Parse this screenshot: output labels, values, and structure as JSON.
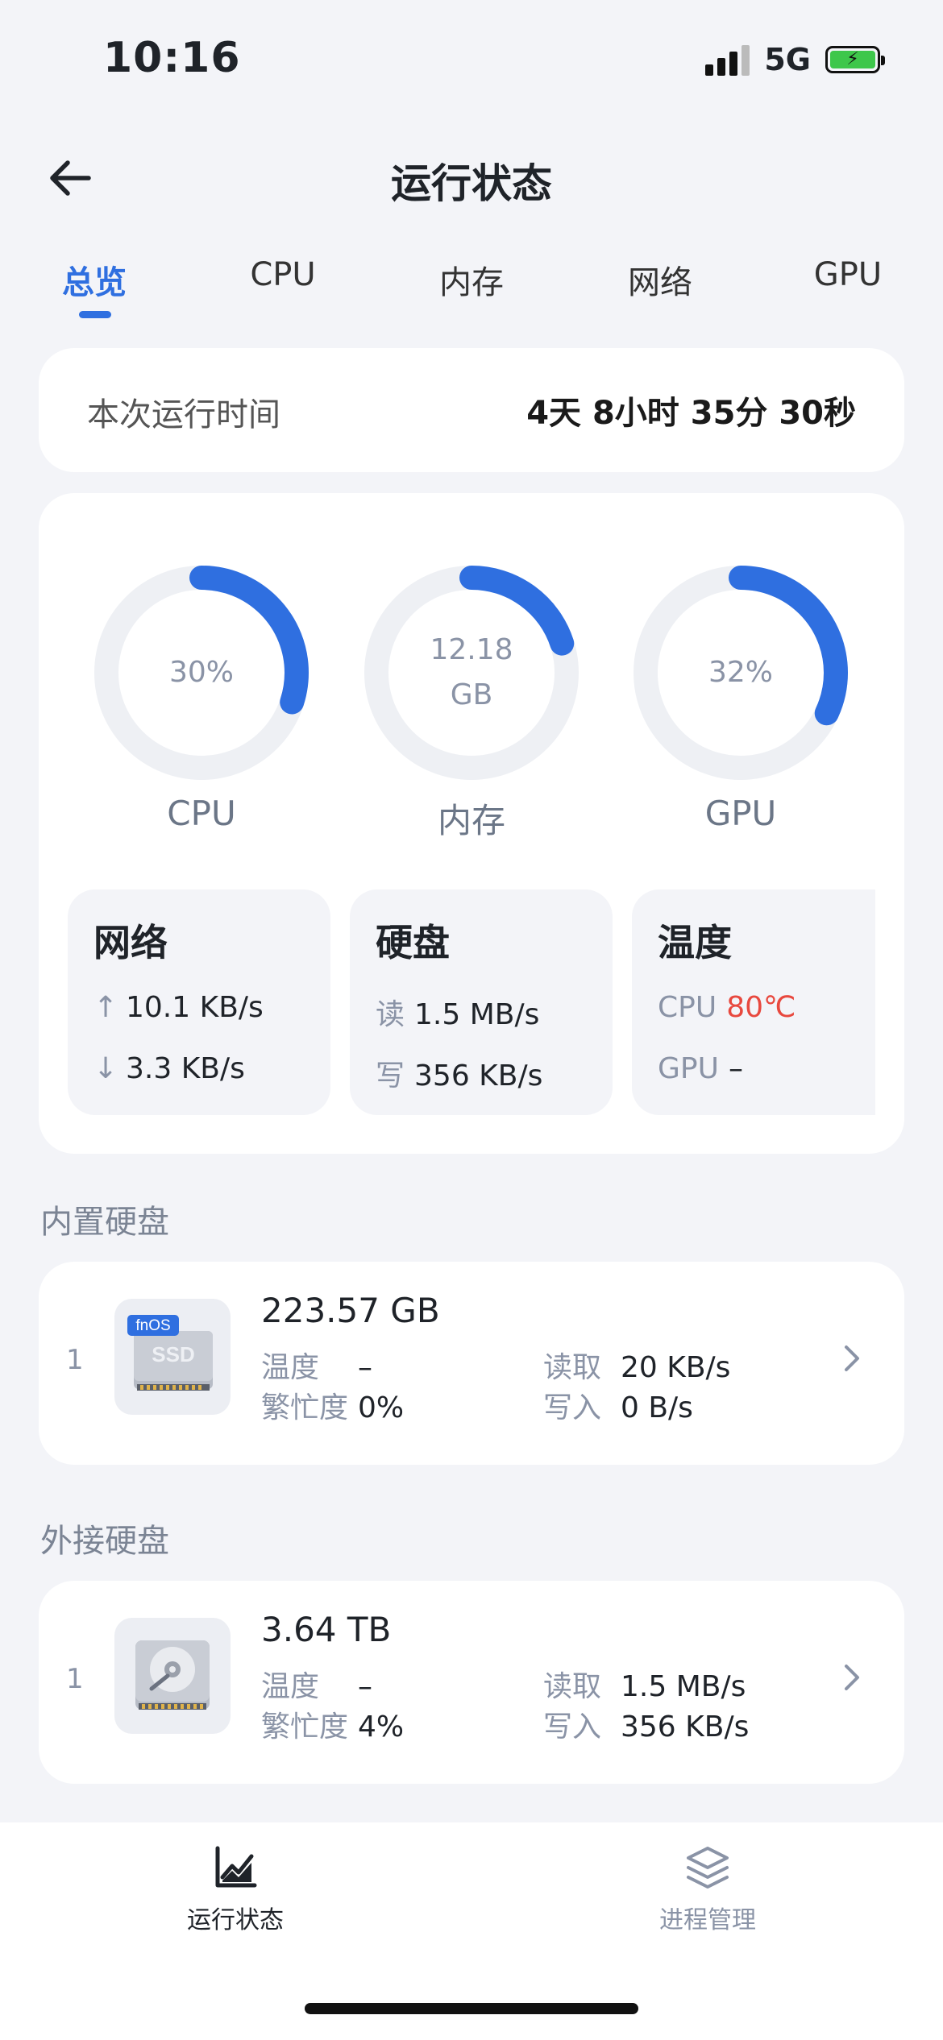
{
  "status_bar": {
    "time": "10:16",
    "network": "5G"
  },
  "header": {
    "title": "运行状态"
  },
  "tabs": [
    {
      "label": "总览",
      "active": true
    },
    {
      "label": "CPU"
    },
    {
      "label": "内存"
    },
    {
      "label": "网络"
    },
    {
      "label": "GPU"
    }
  ],
  "uptime": {
    "label": "本次运行时间",
    "value": "4天 8小时 35分 30秒"
  },
  "gauges": [
    {
      "label": "CPU",
      "value": "30%",
      "unit": "",
      "fraction": 0.3
    },
    {
      "label": "内存",
      "value": "12.18",
      "unit": "GB",
      "fraction": 0.2
    },
    {
      "label": "GPU",
      "value": "32%",
      "unit": "",
      "fraction": 0.32
    }
  ],
  "network": {
    "title": "网络",
    "up": "10.1 KB/s",
    "down": "3.3 KB/s"
  },
  "disk_io": {
    "title": "硬盘",
    "read_label": "读",
    "read": "1.5 MB/s",
    "write_label": "写",
    "write": "356 KB/s"
  },
  "temperature": {
    "title": "温度",
    "cpu_label": "CPU",
    "cpu": "80℃",
    "gpu_label": "GPU",
    "gpu": "–"
  },
  "internal": {
    "title": "内置硬盘",
    "disk": {
      "index": "1",
      "size": "223.57 GB",
      "badge": "fnOS",
      "type": "SSD",
      "temp_label": "温度",
      "temp": "–",
      "busy_label": "繁忙度",
      "busy": "0%",
      "read_label": "读取",
      "read": "20 KB/s",
      "write_label": "写入",
      "write": "0 B/s"
    }
  },
  "external": {
    "title": "外接硬盘",
    "disk": {
      "index": "1",
      "size": "3.64 TB",
      "temp_label": "温度",
      "temp": "–",
      "busy_label": "繁忙度",
      "busy": "4%",
      "read_label": "读取",
      "read": "1.5 MB/s",
      "write_label": "写入",
      "write": "356 KB/s"
    }
  },
  "bottom_nav": [
    {
      "label": "运行状态",
      "icon": "chart-line-icon",
      "active": true
    },
    {
      "label": "进程管理",
      "icon": "layers-icon",
      "active": false
    }
  ],
  "colors": {
    "accent": "#2f6fe0",
    "hot": "#e8483e",
    "track": "#eef0f4"
  }
}
